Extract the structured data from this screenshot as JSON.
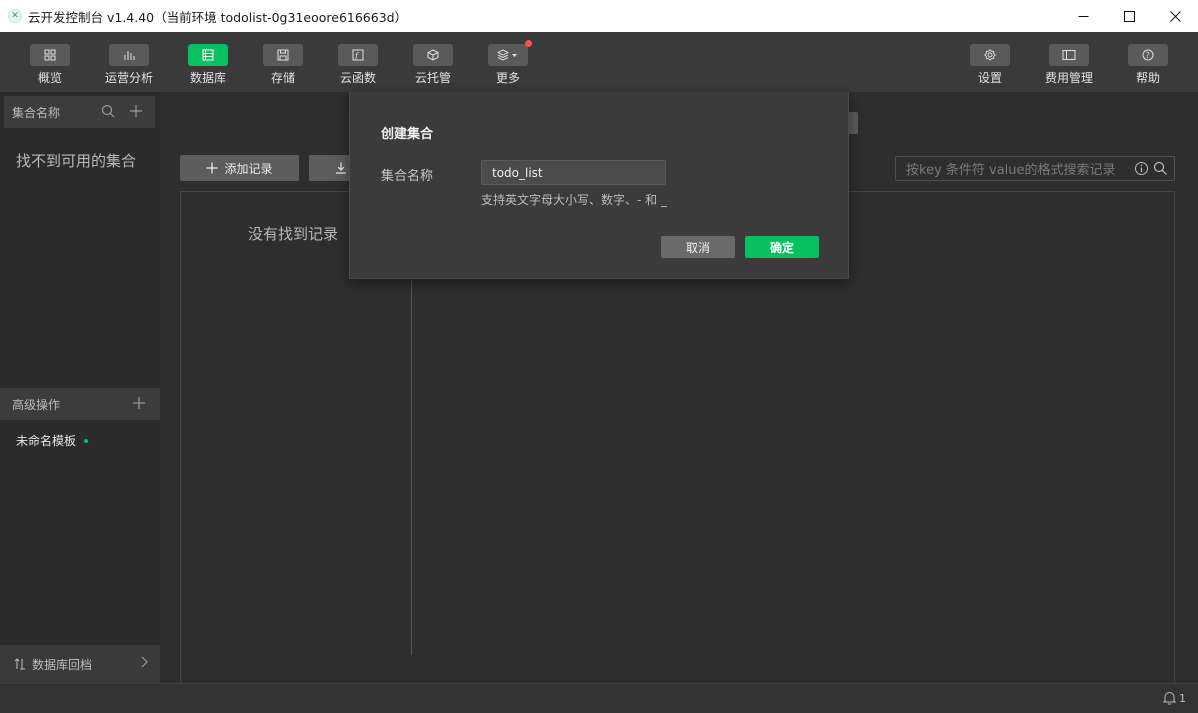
{
  "window": {
    "title": "云开发控制台 v1.4.40（当前环境 todolist-0g31eoore616663d）"
  },
  "toolbar": {
    "left_items": [
      {
        "label": "概览",
        "icon": "grid-icon"
      },
      {
        "label": "运营分析",
        "icon": "bar-chart-icon"
      },
      {
        "label": "数据库",
        "icon": "database-icon",
        "active": true
      },
      {
        "label": "存储",
        "icon": "save-icon"
      },
      {
        "label": "云函数",
        "icon": "function-icon"
      },
      {
        "label": "云托管",
        "icon": "cube-icon"
      },
      {
        "label": "更多",
        "icon": "layers-icon",
        "badge": true
      }
    ],
    "right_items": [
      {
        "label": "设置",
        "icon": "gear-icon"
      },
      {
        "label": "费用管理",
        "icon": "billing-icon"
      },
      {
        "label": "帮助",
        "icon": "help-icon"
      }
    ]
  },
  "sidebar": {
    "collections_header": "集合名称",
    "empty_text": "找不到可用的集合",
    "advanced_header": "高级操作",
    "template_item": "未命名模板",
    "rollback_label": "数据库回档"
  },
  "main": {
    "add_record_label": "添加记录",
    "search_placeholder": "按key 条件符 value的格式搜索记录",
    "no_records_text": "没有找到记录"
  },
  "modal": {
    "title": "创建集合",
    "field_label": "集合名称",
    "field_value": "todo_list",
    "hint": "支持英文字母大小写、数字、- 和 _",
    "cancel_label": "取消",
    "ok_label": "确定"
  },
  "statusbar": {
    "notification_count": "1"
  },
  "colors": {
    "accent": "#07c160",
    "badge": "#fa5151"
  }
}
